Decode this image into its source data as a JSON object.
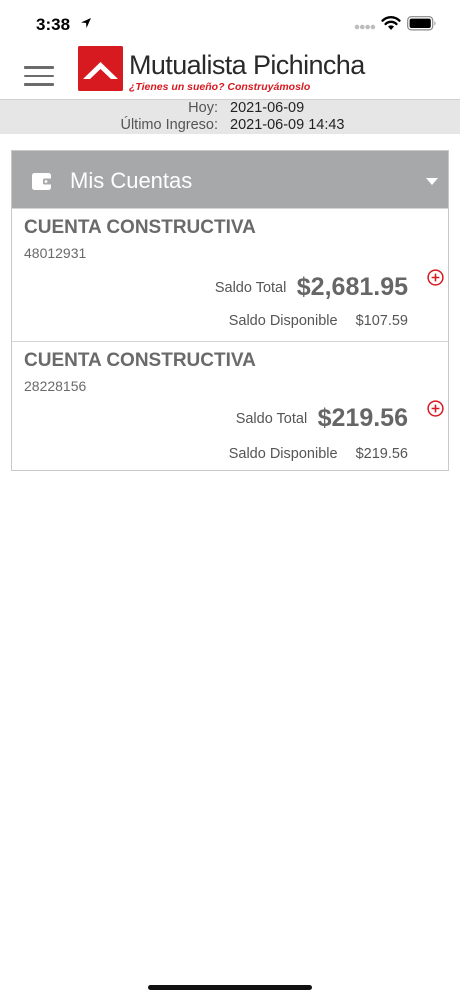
{
  "status_bar": {
    "time": "3:38"
  },
  "header": {
    "logo_name": "Mutualista Pichincha",
    "logo_tagline": "¿Tienes un sueño? Construyámoslo"
  },
  "info": {
    "hoy_label": "Hoy:",
    "hoy_value": "2021-06-09",
    "ultimo_label": "Último Ingreso:",
    "ultimo_value": "2021-06-09 14:43"
  },
  "accounts_panel": {
    "title": "Mis Cuentas",
    "accounts": [
      {
        "name": "CUENTA CONSTRUCTIVA",
        "number": "48012931",
        "saldo_total_label": "Saldo Total",
        "saldo_total": "$2,681.95",
        "saldo_disponible_label": "Saldo Disponible",
        "saldo_disponible": "$107.59"
      },
      {
        "name": "CUENTA CONSTRUCTIVA",
        "number": "28228156",
        "saldo_total_label": "Saldo Total",
        "saldo_total": "$219.56",
        "saldo_disponible_label": "Saldo Disponible",
        "saldo_disponible": "$219.56"
      }
    ]
  },
  "colors": {
    "brand_red": "#d71920",
    "panel_header": "#a7a8aa"
  }
}
